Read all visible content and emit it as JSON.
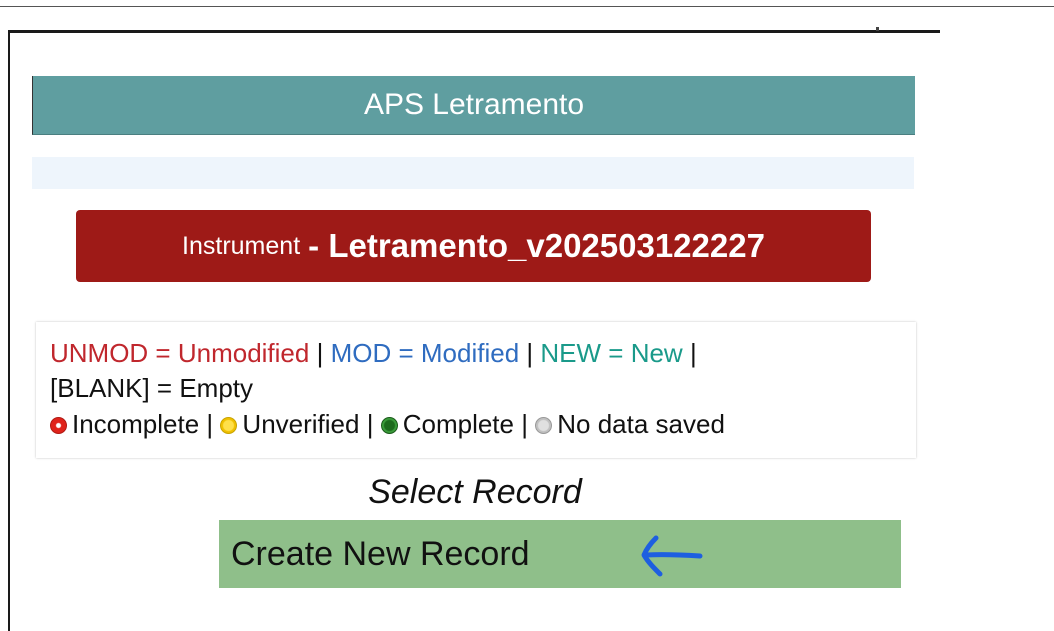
{
  "header": {
    "title": "APS Letramento"
  },
  "instrument": {
    "label": "Instrument",
    "separator": "-",
    "name": "Letramento_v202503122227"
  },
  "legend": {
    "unmod": "UNMOD = Unmodified",
    "mod": "MOD = Modified",
    "new": "NEW = New",
    "blank": "[BLANK] = Empty",
    "separator": "|",
    "statuses": {
      "incomplete": "Incomplete",
      "unverified": "Unverified",
      "complete": "Complete",
      "no_data": "No data saved"
    }
  },
  "select_record": {
    "title": "Select Record",
    "create_button": "Create New Record"
  },
  "icons": {
    "arrow": "arrow-left-icon"
  },
  "colors": {
    "header": "#5f9ea0",
    "instrument_banner": "#9e1a17",
    "create_button": "#8fbf8a",
    "unmod_text": "#c0272d",
    "mod_text": "#2f6cc0",
    "new_text": "#1a9a8a",
    "arrow": "#1e5fe0"
  }
}
